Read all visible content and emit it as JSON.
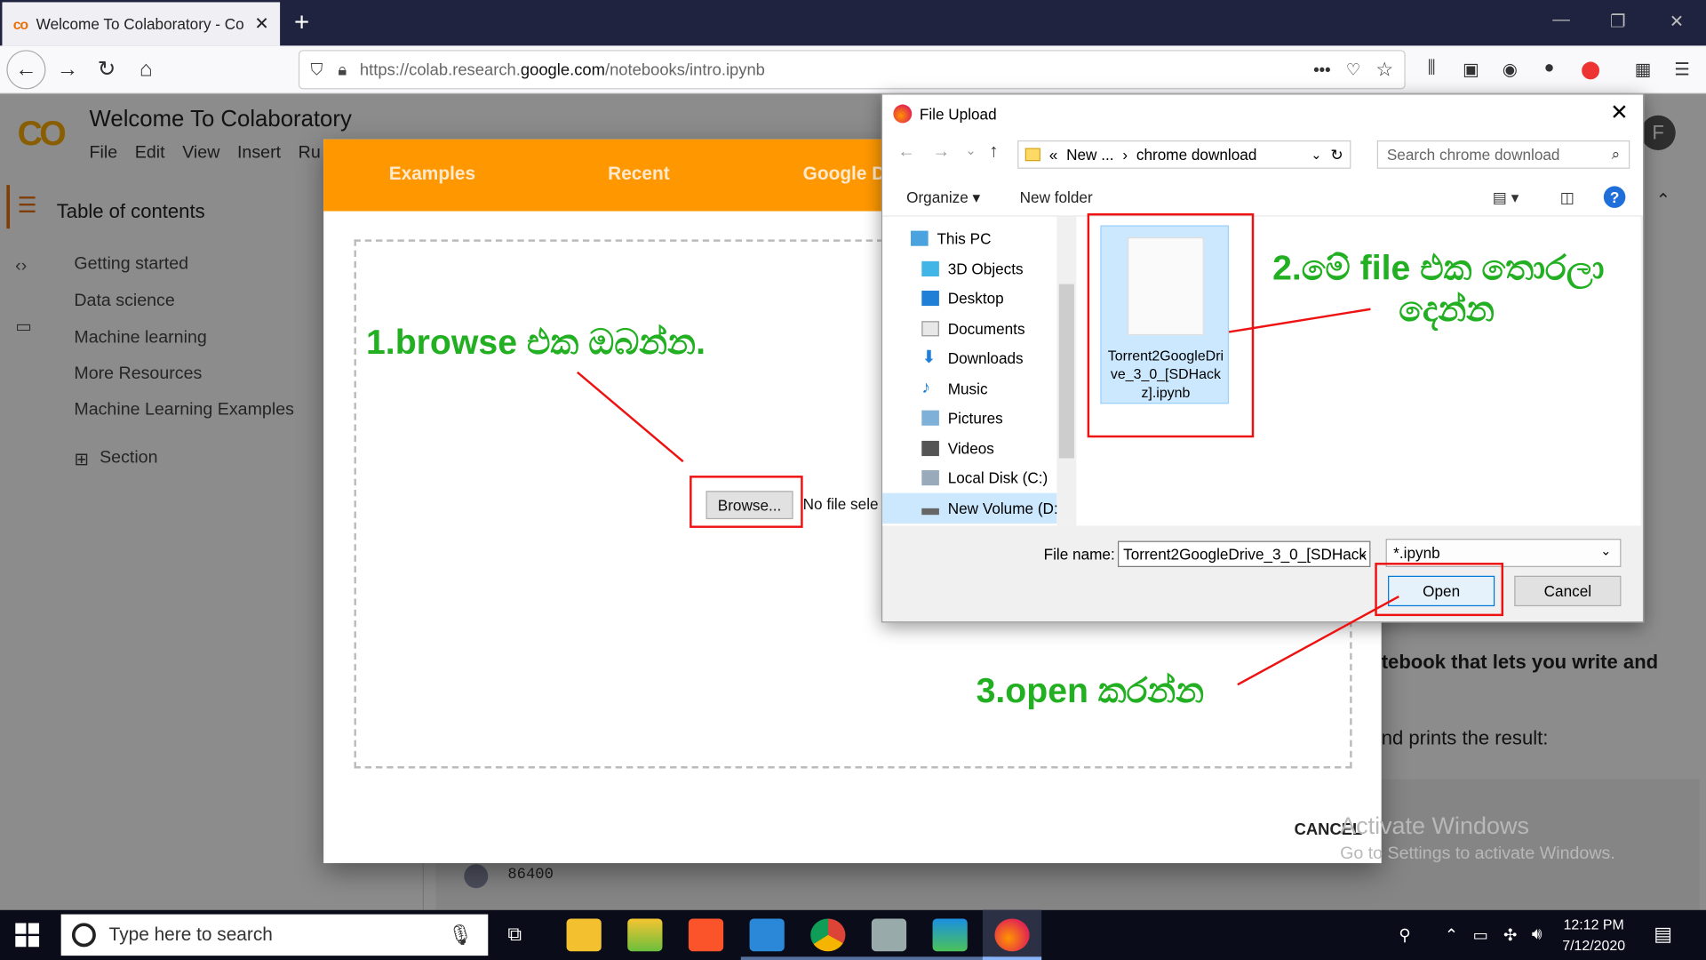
{
  "browser": {
    "tab_title": "Welcome To Colaboratory - Co",
    "tab_logo": "co",
    "url_prefix": "https://colab.research.",
    "url_domain": "google.com",
    "url_path": "/notebooks/intro.ipynb"
  },
  "colab": {
    "logo": "CO",
    "title": "Welcome To Colaboratory",
    "menu": [
      "File",
      "Edit",
      "View",
      "Insert",
      "Ru"
    ],
    "toc_title": "Table of contents",
    "toc_items": [
      "Getting started",
      "Data science",
      "Machine learning",
      "More Resources",
      "Machine Learning Examples"
    ],
    "section_label": "Section",
    "avatar_letter": "F",
    "body_text_1": "tebook that lets you write and",
    "body_text_2": "nd prints the result:",
    "cell_output": "86400"
  },
  "modal": {
    "tabs": [
      "Examples",
      "Recent",
      "Google D"
    ],
    "browse_label": "Browse...",
    "no_file_text": "No file sele",
    "cancel_label": "CANCEL"
  },
  "dialog": {
    "title": "File Upload",
    "breadcrumb_prefix": "«",
    "breadcrumb_1": "New ...",
    "breadcrumb_sep": "›",
    "breadcrumb_2": "chrome download",
    "search_placeholder": "Search chrome download",
    "organize": "Organize",
    "new_folder": "New folder",
    "nav_items": [
      {
        "label": "This PC",
        "icon": "pc-icon"
      },
      {
        "label": "3D Objects",
        "icon": "cube-icon"
      },
      {
        "label": "Desktop",
        "icon": "desktop-icon"
      },
      {
        "label": "Documents",
        "icon": "document-icon"
      },
      {
        "label": "Downloads",
        "icon": "download-icon"
      },
      {
        "label": "Music",
        "icon": "music-icon"
      },
      {
        "label": "Pictures",
        "icon": "picture-icon"
      },
      {
        "label": "Videos",
        "icon": "video-icon"
      },
      {
        "label": "Local Disk (C:)",
        "icon": "disk-icon"
      },
      {
        "label": "New Volume (D:",
        "icon": "drive-icon"
      }
    ],
    "file_item_name": "Torrent2GoogleDrive_3_0_[SDHackz].ipynb",
    "file_name_label": "File name:",
    "file_name_value": "Torrent2GoogleDrive_3_0_[SDHack",
    "file_type": "*.ipynb",
    "open_label": "Open",
    "cancel_label": "Cancel"
  },
  "annotations": {
    "step1": "1.browse එක ඔබන්න.",
    "step2_line1": "2.මේ file එක තොරලා",
    "step2_line2": "දෙන්න",
    "step3": "3.open කරන්න"
  },
  "watermark": {
    "line1": "Activate Windows",
    "line2": "Go to Settings to activate Windows."
  },
  "taskbar": {
    "search_placeholder": "Type here to search",
    "time": "12:12 PM",
    "date": "7/12/2020"
  },
  "colors": {
    "colab_orange": "#ff9800",
    "annotation_green": "#22b022",
    "annotation_red": "#e11111",
    "taskbar": "#0a0d19"
  }
}
